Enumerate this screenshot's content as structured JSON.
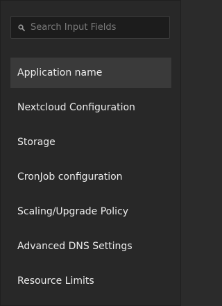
{
  "search": {
    "placeholder": "Search Input Fields",
    "icon": "search-icon"
  },
  "nav": {
    "active_index": 0,
    "items": [
      {
        "label": "Application name"
      },
      {
        "label": "Nextcloud Configuration"
      },
      {
        "label": "Storage"
      },
      {
        "label": "CronJob configuration"
      },
      {
        "label": "Scaling/Upgrade Policy"
      },
      {
        "label": "Advanced DNS Settings"
      },
      {
        "label": "Resource Limits"
      }
    ]
  },
  "colors": {
    "background": "#282828",
    "active_item": "#3a3a3a",
    "text": "#ececec",
    "placeholder": "#7a7a7a"
  }
}
